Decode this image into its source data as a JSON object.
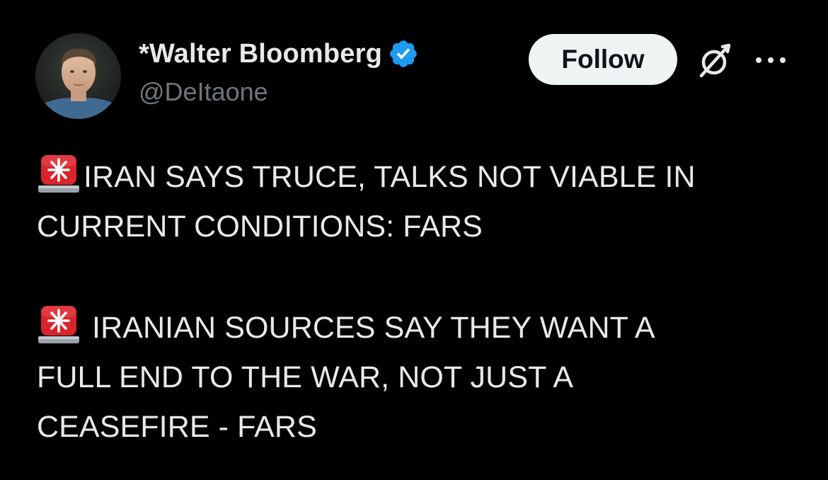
{
  "author": {
    "display_name": "*Walter Bloomberg",
    "handle": "@DeItaone",
    "verified": true,
    "verified_color": "#1d9bf0",
    "avatar_icon": "profile-photo"
  },
  "actions": {
    "follow_label": "Follow",
    "grok_icon": "grok-icon",
    "more_icon": "more-options-icon"
  },
  "tweet": {
    "paragraphs": [
      {
        "emoji": "police-car-light",
        "lines": [
          "IRAN SAYS TRUCE, TALKS NOT VIABLE IN",
          "CURRENT CONDITIONS: FARS"
        ]
      },
      {
        "emoji": "police-car-light",
        "lines": [
          " IRANIAN SOURCES SAY THEY WANT A",
          "FULL END TO THE WAR, NOT JUST A",
          "CEASEFIRE - FARS"
        ]
      }
    ]
  },
  "colors": {
    "background": "#000000",
    "text_primary": "#e7e9ea",
    "text_secondary": "#71767b",
    "button_bg": "#eff3f4",
    "button_text": "#0f1419"
  }
}
